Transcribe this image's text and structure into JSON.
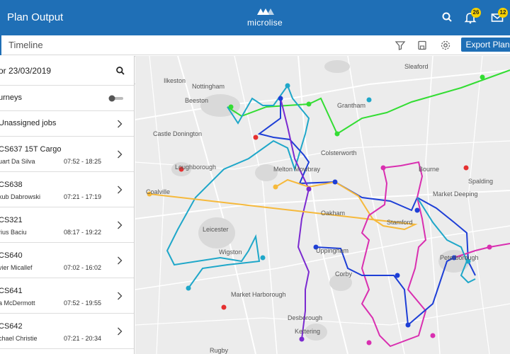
{
  "header": {
    "title": "Plan Output",
    "brand": "microlise",
    "notifications_count": "26",
    "messages_count": "12"
  },
  "toolbar": {
    "tab_label": "Timeline",
    "export_label": "Export Plan"
  },
  "sidebar": {
    "date_label": "or 23/03/2019",
    "journeys_label": "urneys",
    "unassigned_label": "Unassigned jobs",
    "vehicles": [
      {
        "name": "CS637 15T Cargo",
        "driver": "uart Da Silva",
        "time": "07:52 - 18:25"
      },
      {
        "name": "CS638",
        "driver": "kub Dabrowski",
        "time": "07:21 - 17:19"
      },
      {
        "name": "CS321",
        "driver": "rius Baciu",
        "time": "08:17 - 19:22"
      },
      {
        "name": "CS640",
        "driver": "vier Micallef",
        "time": "07:02 - 16:02"
      },
      {
        "name": "CS641",
        "driver": "a McDermott",
        "time": "07:52 - 19:55"
      },
      {
        "name": "CS642",
        "driver": "chael Christie",
        "time": "07:21 - 20:34"
      }
    ]
  },
  "map": {
    "places": [
      "Nottingham",
      "Beeston",
      "Grantham",
      "Sleaford",
      "Loughborough",
      "Coalville",
      "Melton Mowbray",
      "Leicester",
      "Wigston",
      "Oakham",
      "Stamford",
      "Bourne",
      "Spalding",
      "Market Deeping",
      "Peterborough",
      "Uppingham",
      "Corby",
      "Market Harborough",
      "Desborough",
      "Kettering",
      "Rugby",
      "Colsterworth",
      "Ilkeston",
      "Castle Donington"
    ],
    "route_colors": {
      "green": "#33dd33",
      "cyan": "#1fa7c9",
      "blue": "#1e3fd6",
      "purple": "#7b2ad0",
      "orange": "#f6b93b",
      "magenta": "#d92fb0",
      "stop": "#e53030"
    }
  }
}
